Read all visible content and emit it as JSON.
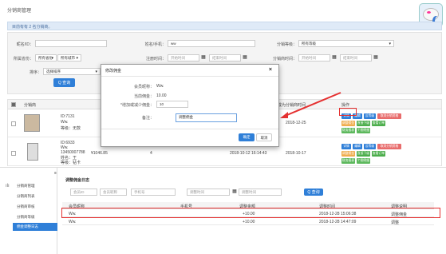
{
  "header": {
    "title": "分销商管理"
  },
  "notice": "目前有有 2 名分销商。",
  "filters": {
    "nickname_label": "昵名/ID：",
    "nickname_value": "",
    "contact_label": "姓名/手机：",
    "contact_value": "ww",
    "level_label": "分销等级：",
    "level_value": "所有等级",
    "region_label": "所属省份：",
    "province_value": "所有省份",
    "city_value": "所有城市",
    "reg_time_label": "注册时间：",
    "start_placeholder": "开始时间",
    "end_placeholder": "结束时间",
    "become_time_label": "分销商时间：",
    "sort_label": "排序：",
    "sort_value": "选择排序",
    "query_label": "Q 查询"
  },
  "table": {
    "headers": {
      "dealer": "分销商",
      "time": "成为分销商时间",
      "ops": "操作"
    },
    "rows": [
      {
        "id": "ID:7131",
        "nick": "Ww.",
        "extra": "",
        "level": "等级：无款",
        "time": "2018-12-25",
        "amount": "",
        "count": ""
      },
      {
        "id": "ID:6933",
        "nick": "Ww.",
        "extra": "13450007788",
        "name": "姓名：王",
        "level": "等级：钻卡",
        "amount": "¥1046.85",
        "count": "4",
        "reg": "2018-10-12 16:14:43",
        "time": "2018-10-17"
      }
    ],
    "actions": [
      "详情",
      "编辑",
      "设等级",
      "取消分销资格",
      "调整佣金",
      "直接下级",
      "查看订单",
      "财务报表",
      "个税明细"
    ]
  },
  "modal": {
    "title": "修改佣金",
    "close": "×",
    "nick_label": "会员昵称：",
    "nick_value": "Ww.",
    "current_label": "当前佣金：",
    "current_value": "10.00",
    "adjust_label": "*增加或减少佣金：",
    "adjust_value": "10",
    "remark_label": "备注：",
    "remark_value": "调整佣金",
    "ok": "确定",
    "cancel": "取消"
  },
  "sidebar": {
    "items": [
      "分销商管理",
      "分销商列表",
      "分销商审核",
      "分销商等级",
      "佣金调整日志"
    ]
  },
  "log": {
    "title": "调整佣金日志",
    "filters": [
      "会员ID",
      "会员昵称",
      "手机号",
      "调整时间",
      "调整时间"
    ],
    "query": "Q 查询",
    "headers": [
      "会员昵称",
      "手机号",
      "调整金额",
      "调整时间",
      "调整说明"
    ],
    "rows": [
      {
        "nick": "Ww.",
        "phone": "",
        "amount": "+10.00",
        "time": "2018-12-28 15:06:38",
        "desc": "调整佣金"
      },
      {
        "nick": "Ww.",
        "phone": "",
        "amount": "+10.00",
        "time": "2018-12-28 14:47:09",
        "desc": "调整"
      }
    ]
  }
}
